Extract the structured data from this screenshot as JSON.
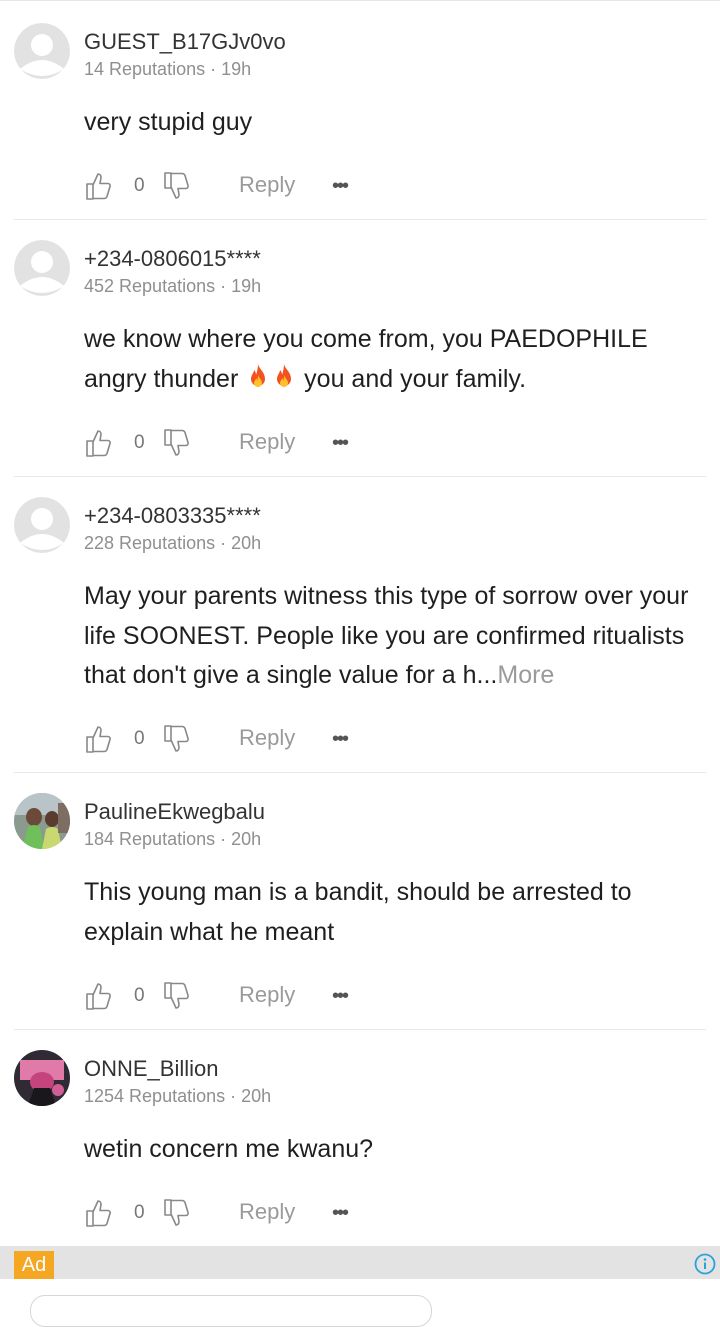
{
  "comments": [
    {
      "username": "GUEST_B17GJv0vo",
      "reputations": "14 Reputations",
      "time": "19h",
      "text": "very stupid guy",
      "likes": "0",
      "reply_label": "Reply",
      "avatar": "default-avatar-icon"
    },
    {
      "username": "+234-0806015****",
      "reputations": "452 Reputations",
      "time": "19h",
      "text_parts": [
        "we know where you come from, you PAEDOPHILE angry thunder ",
        " you and your family."
      ],
      "emoji": "fire-emoji",
      "likes": "0",
      "reply_label": "Reply",
      "avatar": "default-avatar-icon"
    },
    {
      "username": "+234-0803335****",
      "reputations": "228 Reputations",
      "time": "20h",
      "text": "May your parents witness this type of sorrow over your life SOONEST. People like you are confirmed ritualists that don't give a single value for a h...",
      "more_label": "More",
      "likes": "0",
      "reply_label": "Reply",
      "avatar": "default-avatar-icon"
    },
    {
      "username": "PaulineEkwegbalu",
      "reputations": "184 Reputations",
      "time": "20h",
      "text": "This young man is a bandit, should be arrested to explain what he meant",
      "likes": "0",
      "reply_label": "Reply",
      "avatar": "photo-avatar"
    },
    {
      "username": "ONNE_Billion",
      "reputations": "1254 Reputations",
      "time": "20h",
      "text": "wetin concern me kwanu?",
      "likes": "0",
      "reply_label": "Reply",
      "avatar": "photo-avatar"
    }
  ],
  "meta_separator": " · ",
  "ad": {
    "label": "Ad",
    "icon": "info-icon"
  },
  "icons": {
    "like": "thumbs-up-icon",
    "dislike": "thumbs-down-icon",
    "more": "more-dots-icon",
    "more_glyph": "•••"
  },
  "colors": {
    "ad_badge": "#f5a623",
    "info": "#2aa3d8",
    "meta_text": "#8f8f8f",
    "more_link": "#9a9a9a"
  }
}
